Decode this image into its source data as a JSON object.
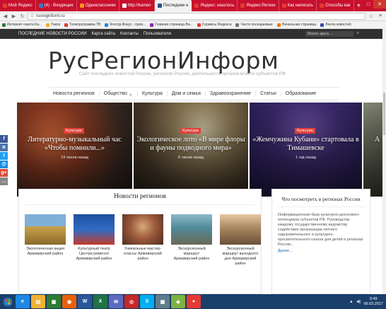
{
  "browser": {
    "tabs": [
      {
        "label": "Мой Яндекс",
        "color": "#e23d2f",
        "active": false
      },
      {
        "label": "(4) - Входящие",
        "color": "#3b75c2",
        "active": false
      },
      {
        "label": "Одноклассники",
        "color": "#f7931e",
        "active": false
      },
      {
        "label": "http://kamen",
        "color": "#ffffff",
        "active": false
      },
      {
        "label": "Последние н",
        "color": "#2e4e8f",
        "active": true
      },
      {
        "label": "Яндекс: нашлось",
        "color": "#e23d2f",
        "active": false
      },
      {
        "label": "Яндекс:Регион",
        "color": "#e23d2f",
        "active": false
      },
      {
        "label": "Как написать",
        "color": "#e23d2f",
        "active": false
      },
      {
        "label": "Способы как",
        "color": "#e23d2f",
        "active": false
      }
    ],
    "url": "rusreginform.ru",
    "bookmarks": [
      {
        "label": "Интернет-газета Ка...",
        "color": "#2e7d32"
      },
      {
        "label": "Такси",
        "color": "#f9a825"
      },
      {
        "label": "Телепрограмма ТВ",
        "color": "#e23d2f"
      },
      {
        "label": "Контур.Фокус - пров...",
        "color": "#1e88e5"
      },
      {
        "label": "Главная страница Ва...",
        "color": "#8e24aa"
      },
      {
        "label": "Сервисы Яндекса",
        "color": "#e23d2f"
      },
      {
        "label": "Часто посещаемые",
        "color": "#757575"
      },
      {
        "label": "Начальная страница",
        "color": "#f57c00"
      },
      {
        "label": "Лента новостей",
        "color": "#3949ab"
      }
    ]
  },
  "site": {
    "topnav": [
      "ПОСЛЕДНИЕ НОВОСТИ РОССИИ",
      "Карта сайта",
      "Контакты",
      "Пользователи"
    ],
    "search_placeholder": "Искать здесь ...",
    "logo": "РусРегионИнформ",
    "tagline": "Сайт последних новостей России, регионов России, деятельность органов власти субъектов РФ",
    "categories": [
      {
        "label": "Новости регионов",
        "dropdown": false
      },
      {
        "label": "Общество",
        "dropdown": true
      },
      {
        "label": "Культура",
        "dropdown": false
      },
      {
        "label": "Дом и семья",
        "dropdown": false
      },
      {
        "label": "Здравоохранение",
        "dropdown": false
      },
      {
        "label": "Статьи",
        "dropdown": false
      },
      {
        "label": "Образование",
        "dropdown": false
      }
    ],
    "slides": [
      {
        "category": "Культура",
        "title": "Литературно-музыкальный час «Чтобы помнили...»",
        "date": "19 часов назад"
      },
      {
        "category": "Культура",
        "title": "Экологическое лото «В мире флоры и фауны подводного мира»",
        "date": "6 часов назад"
      },
      {
        "category": "Культура",
        "title": "«Жемчужина Кубани» стартовала в Тимашевске",
        "date": "1 год назад"
      },
      {
        "category": "",
        "title": "А",
        "date": ""
      }
    ],
    "share_buttons": [
      "f",
      "в",
      "t",
      "@",
      "g+",
      "…"
    ],
    "main_heading": "Новости регионов",
    "cards": [
      {
        "caption": "Экологическая акция Армавирский район"
      },
      {
        "caption": "Культурный театр Центра ремесел Армавирский район"
      },
      {
        "caption": "Уникальные мастер-классы Армавирский район"
      },
      {
        "caption": "Экскурсионный маршрут Армавирский район"
      },
      {
        "caption": "Экскурсионный маршрут выходного дня Армавирский район"
      }
    ],
    "sidebar": {
      "heading": "Что посмотреть в регионах России",
      "body": "Информационная база культурно-досугового потенциала субъектов РФ. Руководству каждому государственному ведомству содействия организации летнего оздоровительного и культурно-просветительного сезона для детей в регионах России...",
      "more": "Далее..."
    }
  },
  "taskbar": {
    "apps": [
      {
        "glyph": "e",
        "color": "#1e88e5"
      },
      {
        "glyph": "▤",
        "color": "#f2b134"
      },
      {
        "glyph": "▣",
        "color": "#2e7d32"
      },
      {
        "glyph": "◉",
        "color": "#e8600a"
      },
      {
        "glyph": "W",
        "color": "#2b579a"
      },
      {
        "glyph": "X",
        "color": "#217346"
      },
      {
        "glyph": "✉",
        "color": "#5c6bc0"
      },
      {
        "glyph": "◎",
        "color": "#c62828"
      },
      {
        "glyph": "S",
        "color": "#00aff0"
      },
      {
        "glyph": "▦",
        "color": "#607d8b"
      },
      {
        "glyph": "◆",
        "color": "#7cb342"
      },
      {
        "glyph": "●",
        "color": "#e53935"
      }
    ],
    "time": "0:49",
    "date": "06.03.2017"
  }
}
